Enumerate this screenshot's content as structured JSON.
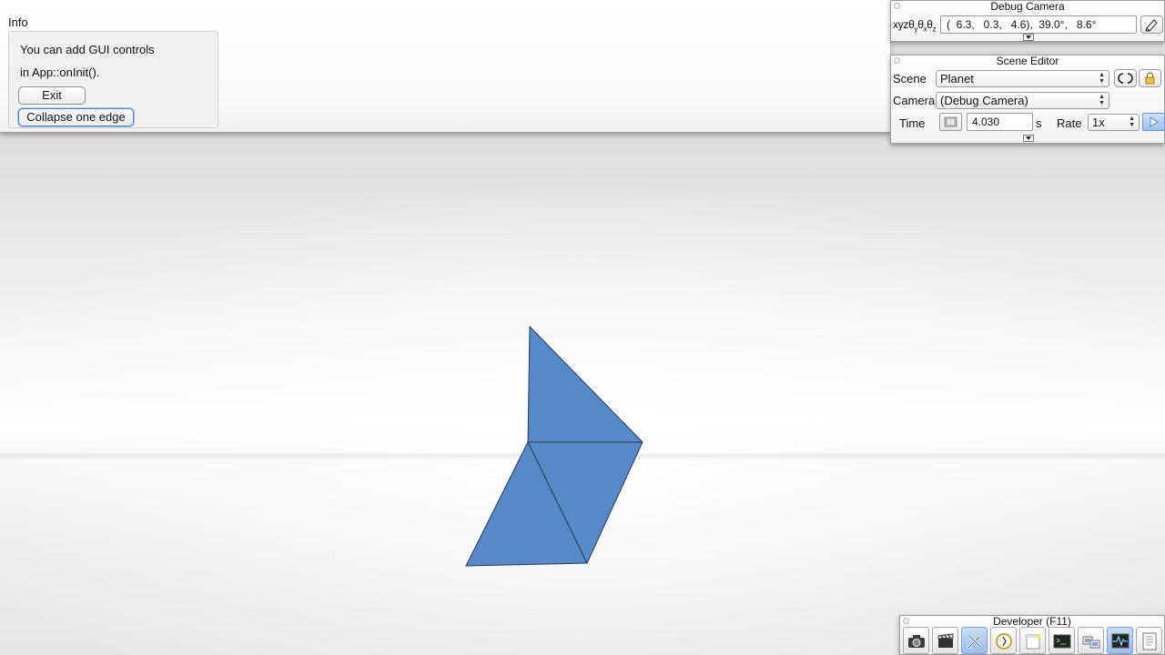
{
  "info": {
    "title": "Info",
    "line1": "You can add GUI controls",
    "line2": "in App::onInit().",
    "exit_button": "Exit",
    "collapse_button": "Collapse one edge"
  },
  "debug_camera": {
    "title": "Debug Camera",
    "xyz_label": "xyzθyθxθz",
    "coords": "(  6.3,   0.3,   4.6),  39.0°,   8.6°"
  },
  "scene_editor": {
    "title": "Scene Editor",
    "scene_label": "Scene",
    "scene_value": "Planet",
    "camera_label": "Camera",
    "camera_value": "(Debug Camera)",
    "time_label": "Time",
    "time_value": "4.030",
    "time_unit": "s",
    "rate_label": "Rate",
    "rate_value": "1x"
  },
  "developer": {
    "title": "Developer (F11)",
    "tools": [
      "camera-icon",
      "clapperboard-icon",
      "tools-icon",
      "clock-icon",
      "window-icon",
      "terminal-icon",
      "network-icon",
      "profiler-icon",
      "document-icon"
    ],
    "active_tools": [
      "tools-icon",
      "profiler-icon"
    ]
  },
  "colors": {
    "mesh_fill": "#5788c7",
    "mesh_edge": "#2a3b55",
    "accent_blue": "#4a7fd0"
  }
}
